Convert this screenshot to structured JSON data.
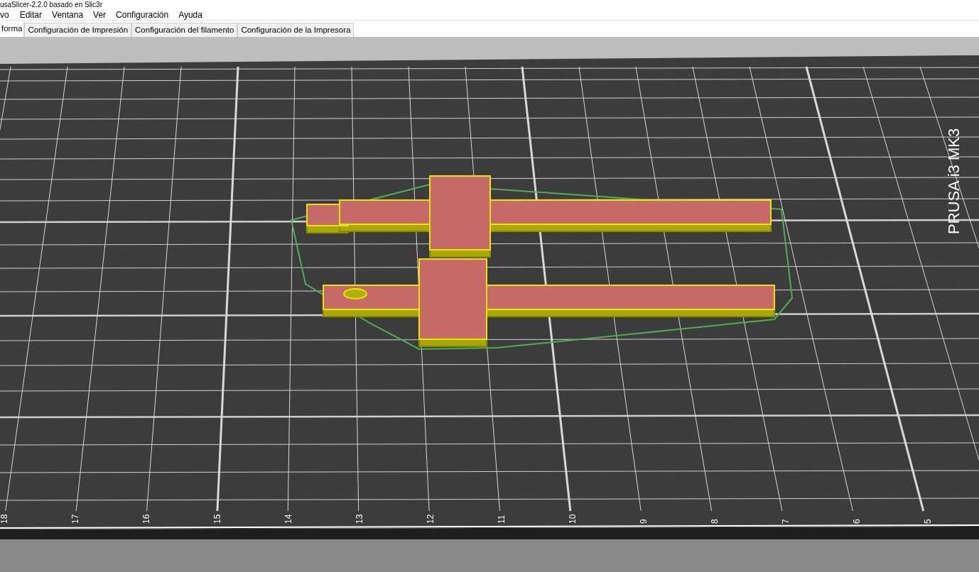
{
  "window": {
    "title": "usaSlicer-2.2.0 basado en Slic3r"
  },
  "menu": [
    "vo",
    "Editar",
    "Ventana",
    "Ver",
    "Configuración",
    "Ayuda"
  ],
  "tabs": [
    {
      "label": "forma",
      "selected": true
    },
    {
      "label": "Configuración de Impresión",
      "selected": false
    },
    {
      "label": "Configuración del filamento",
      "selected": false
    },
    {
      "label": "Configuración de la Impresora",
      "selected": false
    }
  ],
  "bed": {
    "label": "PRUSA i3 MK3",
    "axis_labels": [
      "18",
      "17",
      "16",
      "15",
      "14",
      "13",
      "12",
      "11",
      "10",
      "9",
      "8",
      "7",
      "6",
      "5"
    ]
  }
}
